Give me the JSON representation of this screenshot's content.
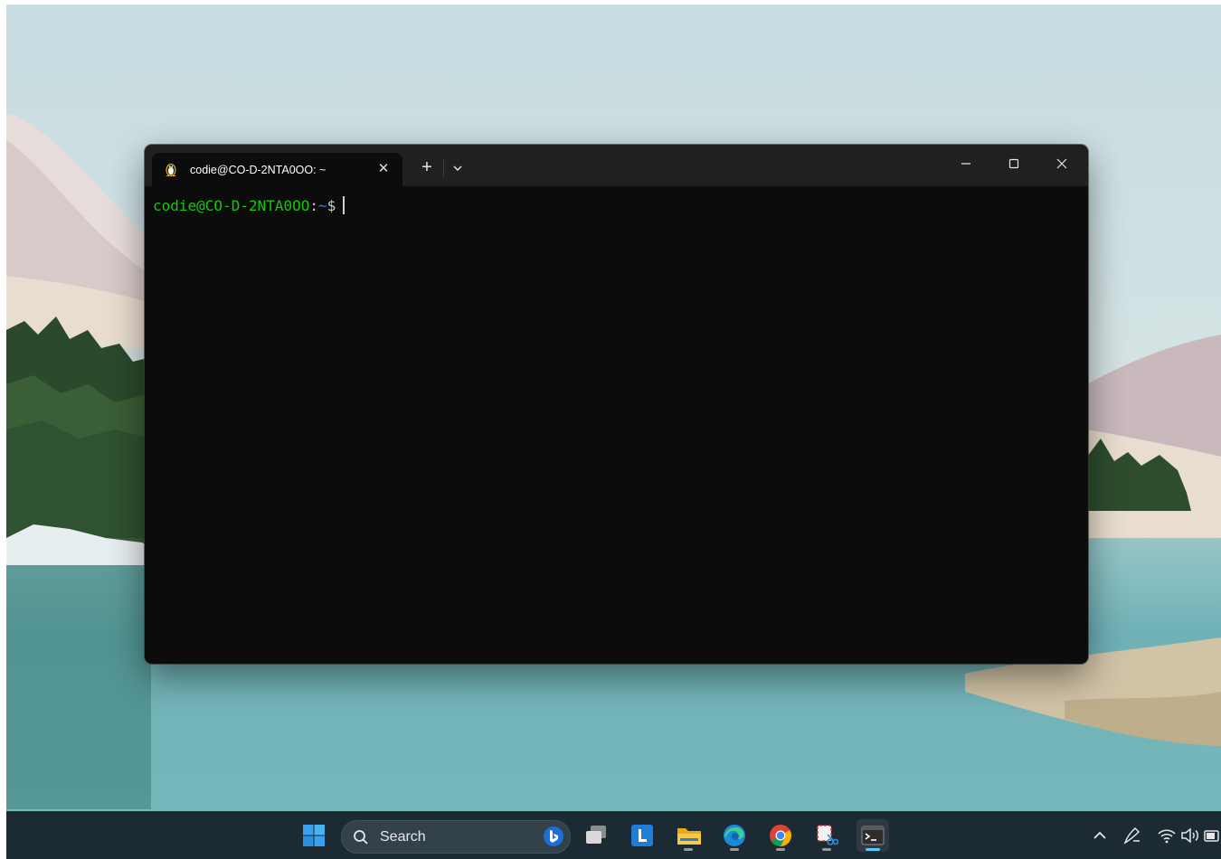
{
  "terminal": {
    "tab_title": "codie@CO-D-2NTA0OO: ~",
    "tab_close_icon": "close-icon",
    "new_tab_label": "+",
    "dropdown_icon": "chevron-down-icon",
    "window_controls": [
      "minimize-icon",
      "maximize-icon",
      "close-icon"
    ],
    "prompt": {
      "user_host": "codie@CO-D-2NTA0OO",
      "colon": ":",
      "path": "~",
      "dollar": "$"
    },
    "colors": {
      "background": "#0c0c0c",
      "titlebar": "#202020",
      "prompt_user": "#16c60c",
      "prompt_path": "#3b78ff"
    }
  },
  "taskbar": {
    "search_placeholder": "Search",
    "apps": [
      "windows-start-icon",
      "task-view-icon",
      "l-app-icon",
      "file-explorer-icon",
      "edge-icon",
      "chrome-icon",
      "snipping-tool-icon",
      "terminal-icon"
    ],
    "active_app": "terminal-icon",
    "tray": [
      "chevron-up-icon",
      "pen-icon",
      "wifi-icon",
      "volume-icon",
      "battery-icon"
    ]
  }
}
